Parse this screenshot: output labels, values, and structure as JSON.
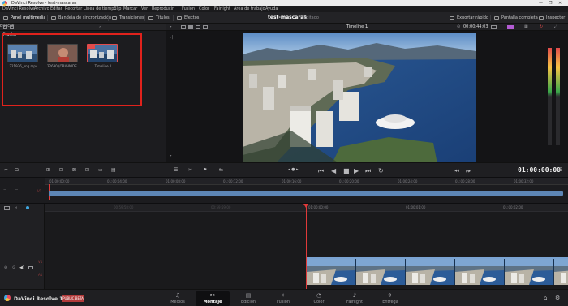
{
  "window": {
    "title": "DaVinci Resolve - test-mascaras",
    "controls": [
      "—",
      "❐",
      "✕"
    ]
  },
  "menu": [
    "DaVinci Resolve",
    "Archivo",
    "Editar",
    "Recortar",
    "Línea de tiempo",
    "Clip",
    "Marcar",
    "Ver",
    "Reproducir",
    "Fusion",
    "Color",
    "Fairlight",
    "Área de trabajo",
    "Ayuda"
  ],
  "toolbar": {
    "media_pool": "Panel multimedia",
    "sync_bin": "Bandeja de sincronización",
    "transitions": "Transiciones",
    "titles": "Títulos",
    "effects": "Efectos",
    "project_title": "test-mascaras",
    "project_status": "Editado",
    "quick_export": "Exportar rápido",
    "fullscreen": "Pantalla completa",
    "inspector": "Inspector"
  },
  "media_pool": {
    "search": "Buscar",
    "bin": "Master",
    "clips": [
      {
        "label": "221936_ong.mp4",
        "selected": false
      },
      {
        "label": "22630 (ORIGINIDE...",
        "selected": false
      },
      {
        "label": "Timeline 1",
        "selected": true
      }
    ]
  },
  "viewer": {
    "timeline_name": "Timeline 1",
    "timecode": "00:00:44:03"
  },
  "transport": {
    "timecode": "01:00:00:00"
  },
  "ruler_upper": [
    "01:00:00:00",
    "01:00:04:00",
    "01:00:08:00",
    "01:00:12:00",
    "01:00:16:00",
    "01:00:20:00",
    "01:00:24:00",
    "01:00:28:00",
    "01:00:32:00"
  ],
  "ruler_lower": [
    "00:59:58:00",
    "00:59:59:00",
    "01:00:00:00",
    "01:00:01:00",
    "01:00:02:00",
    "01:00:03:00",
    "01:00:04:00"
  ],
  "bottom": {
    "brand": "DaVinci Resolve 19",
    "beta": "PUBLIC BETA",
    "pages": [
      "Medios",
      "Montaje",
      "Edición",
      "Fusion",
      "Color",
      "Fairlight",
      "Entrega"
    ],
    "active_page": "Montaje"
  },
  "colors": {
    "accent_red": "#e0221c",
    "playhead": "#e03a3a",
    "clip_blue": "#5d86b5"
  }
}
